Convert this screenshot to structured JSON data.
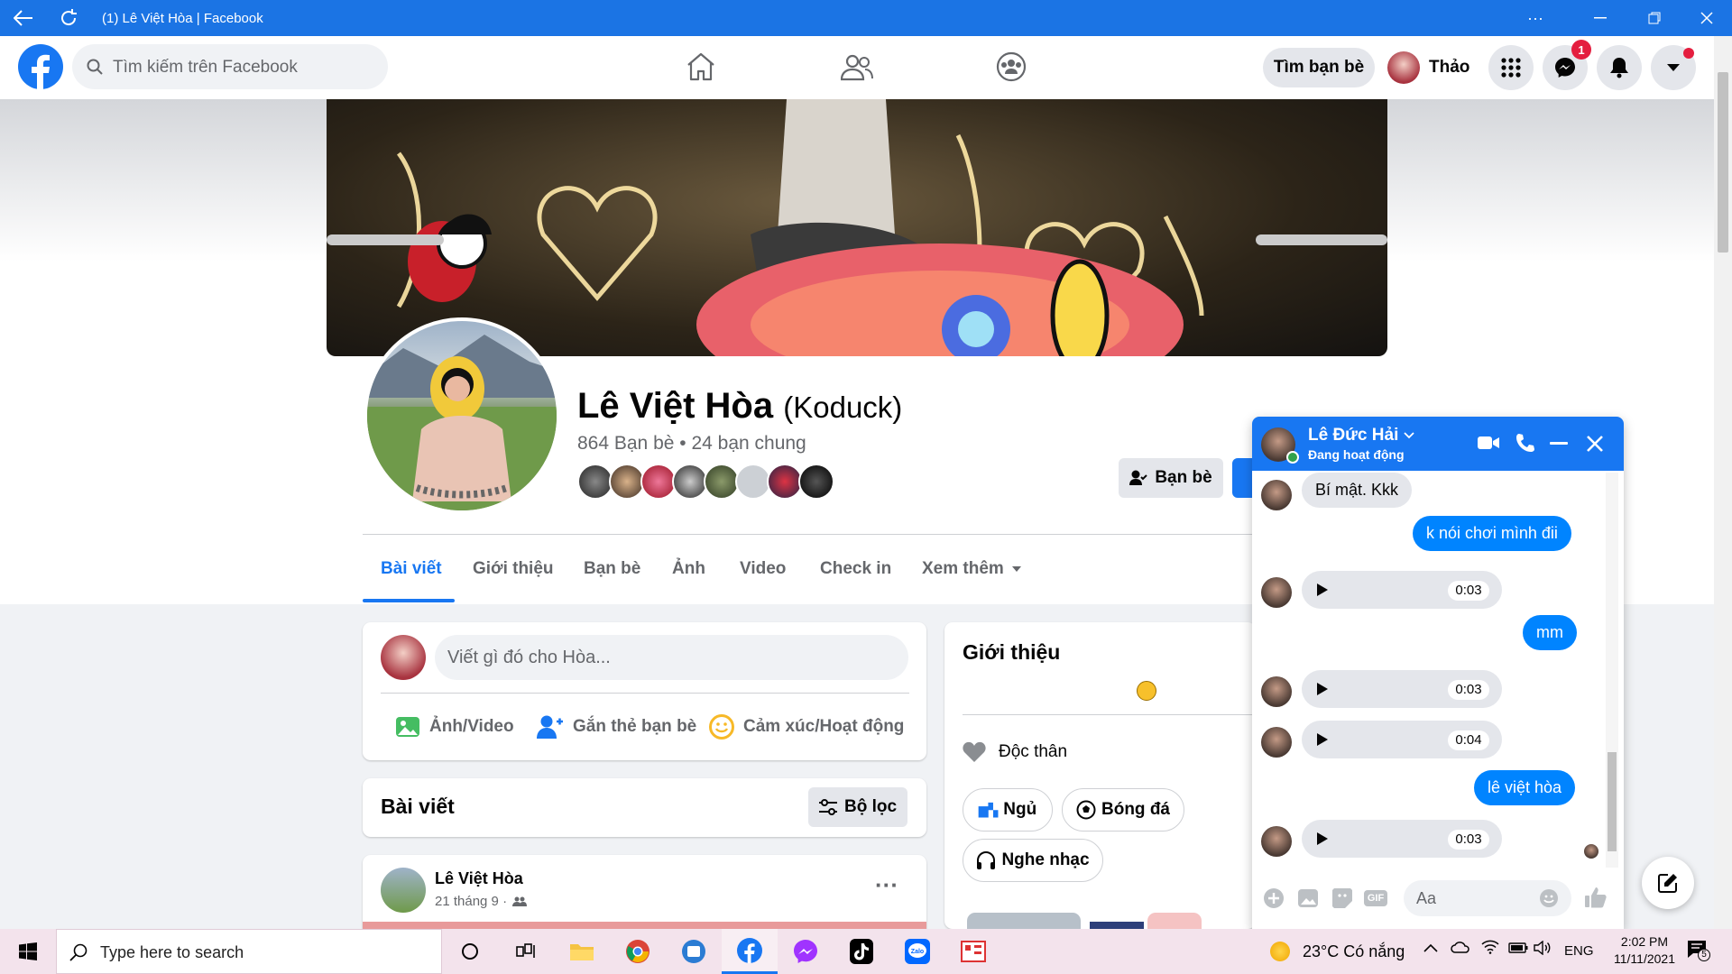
{
  "window": {
    "title": "(1) Lê Việt Hòa | Facebook"
  },
  "header": {
    "search_placeholder": "Tìm kiếm trên Facebook",
    "find_friends": "Tìm bạn bè",
    "user_name": "Thảo",
    "messenger_badge": "1"
  },
  "profile": {
    "name": "Lê Việt Hòa",
    "nickname": "(Koduck)",
    "friends": "864 Bạn bè • 24 bạn chung",
    "friend_button": "Bạn bè",
    "tabs": [
      "Bài viết",
      "Giới thiệu",
      "Bạn bè",
      "Ảnh",
      "Video",
      "Check in",
      "Xem thêm"
    ]
  },
  "composer": {
    "placeholder": "Viết gì đó cho Hòa...",
    "photo": "Ảnh/Video",
    "tag": "Gắn thẻ bạn bè",
    "feeling": "Cảm xúc/Hoạt động"
  },
  "posts": {
    "title": "Bài viết",
    "filter": "Bộ lọc",
    "post_author": "Lê Việt Hòa",
    "post_date": "21 tháng 9 ·"
  },
  "intro": {
    "title": "Giới thiệu",
    "relationship": "Độc thân",
    "hobbies": [
      "Ngủ",
      "Bóng đá",
      "Nghe nhạc"
    ]
  },
  "chat": {
    "contact": "Lê Đức Hải",
    "status": "Đang hoạt động",
    "messages": {
      "m1": "Bí mật. Kkk",
      "m2": "k nói chơi mình đii",
      "a1": "0:03",
      "m3": "mm",
      "a2": "0:03",
      "a3": "0:04",
      "m4": "lê việt hòa",
      "a4": "0:03"
    },
    "input_placeholder": "Aa"
  },
  "taskbar": {
    "search": "Type here to search",
    "weather": "23°C  Có nắng",
    "lang": "ENG",
    "time": "2:02 PM",
    "date": "11/11/2021",
    "notif_count": "5"
  },
  "colors": {
    "brand": "#1877f2",
    "titlebar": "#1b74e4",
    "badge": "#e41e3f"
  }
}
